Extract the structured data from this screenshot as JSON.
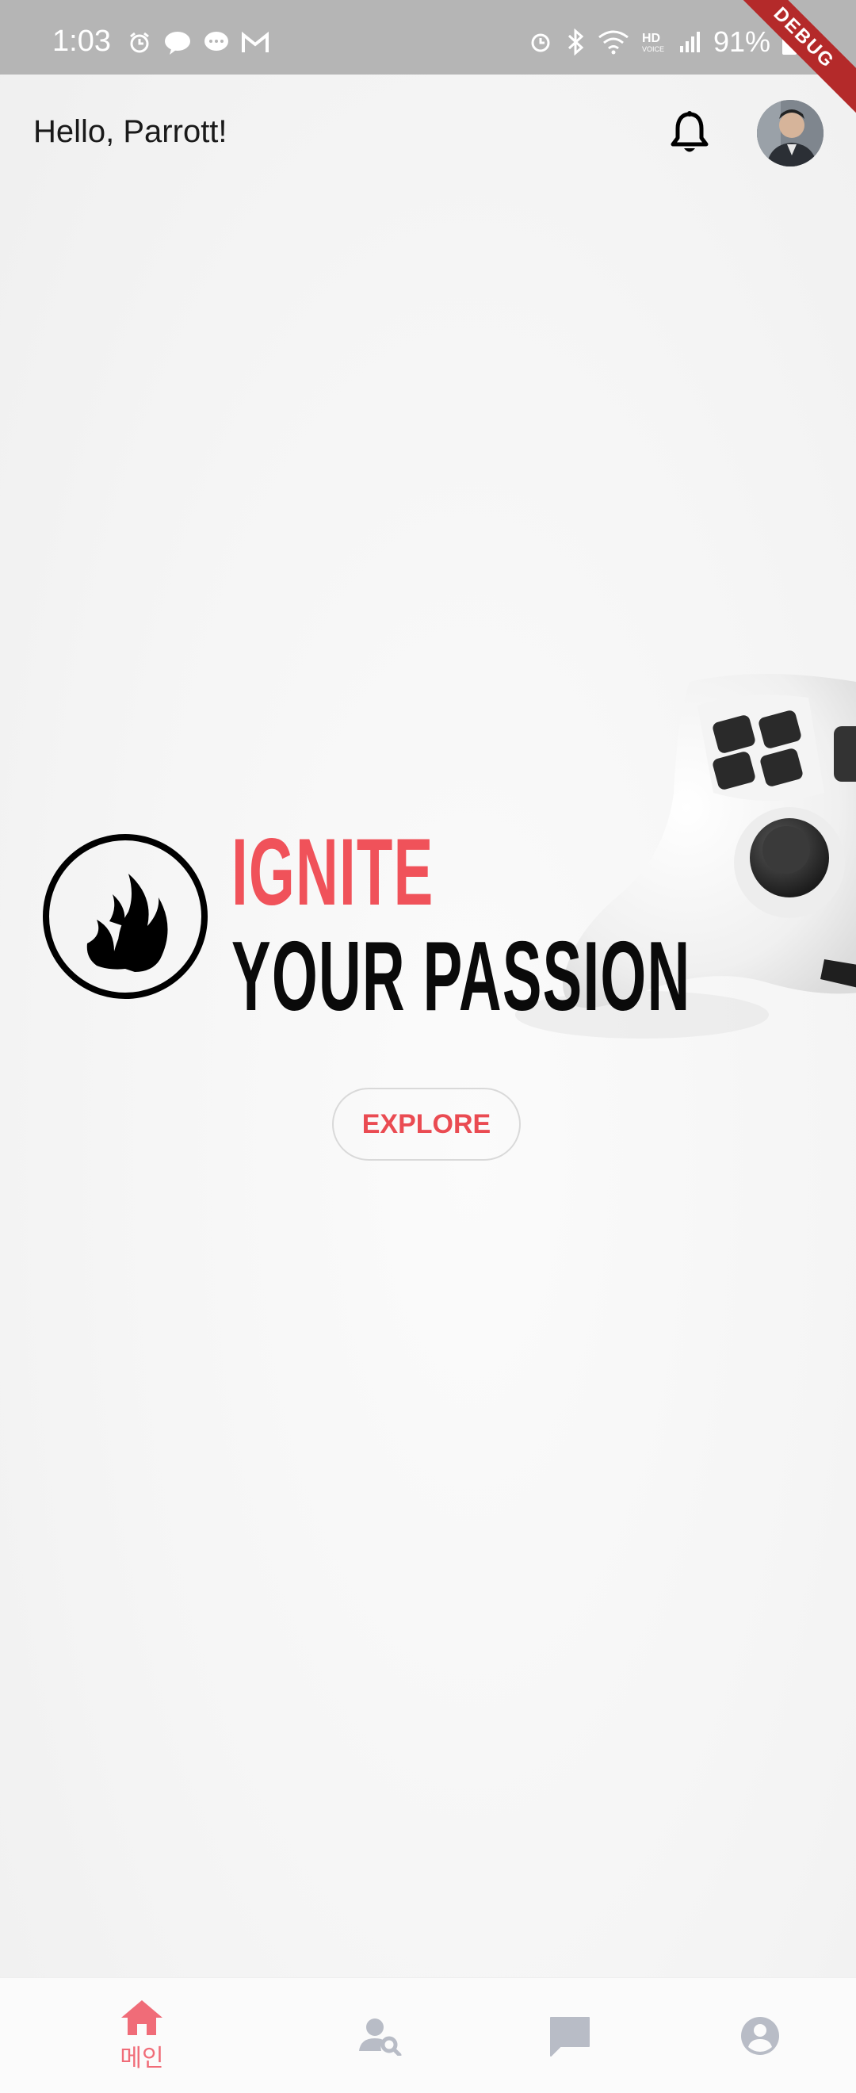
{
  "status_bar": {
    "time": "1:03",
    "battery": "91%",
    "debug_label": "DEBUG"
  },
  "header": {
    "greeting": "Hello, Parrott!"
  },
  "hero": {
    "line1": "IGNITE",
    "line2": "YOUR PASSION",
    "explore_label": "EXPLORE"
  },
  "bottom_nav": {
    "items": [
      {
        "label": "메인",
        "icon": "home-icon",
        "active": true
      },
      {
        "label": "",
        "icon": "user-search-icon",
        "active": false
      },
      {
        "label": "",
        "icon": "chat-icon",
        "active": false
      },
      {
        "label": "",
        "icon": "account-icon",
        "active": false
      }
    ]
  },
  "colors": {
    "accent": "#f0525a",
    "nav_active": "#f06c78",
    "nav_inactive": "#b8bcc6",
    "status_bar": "#b5b5b5"
  }
}
